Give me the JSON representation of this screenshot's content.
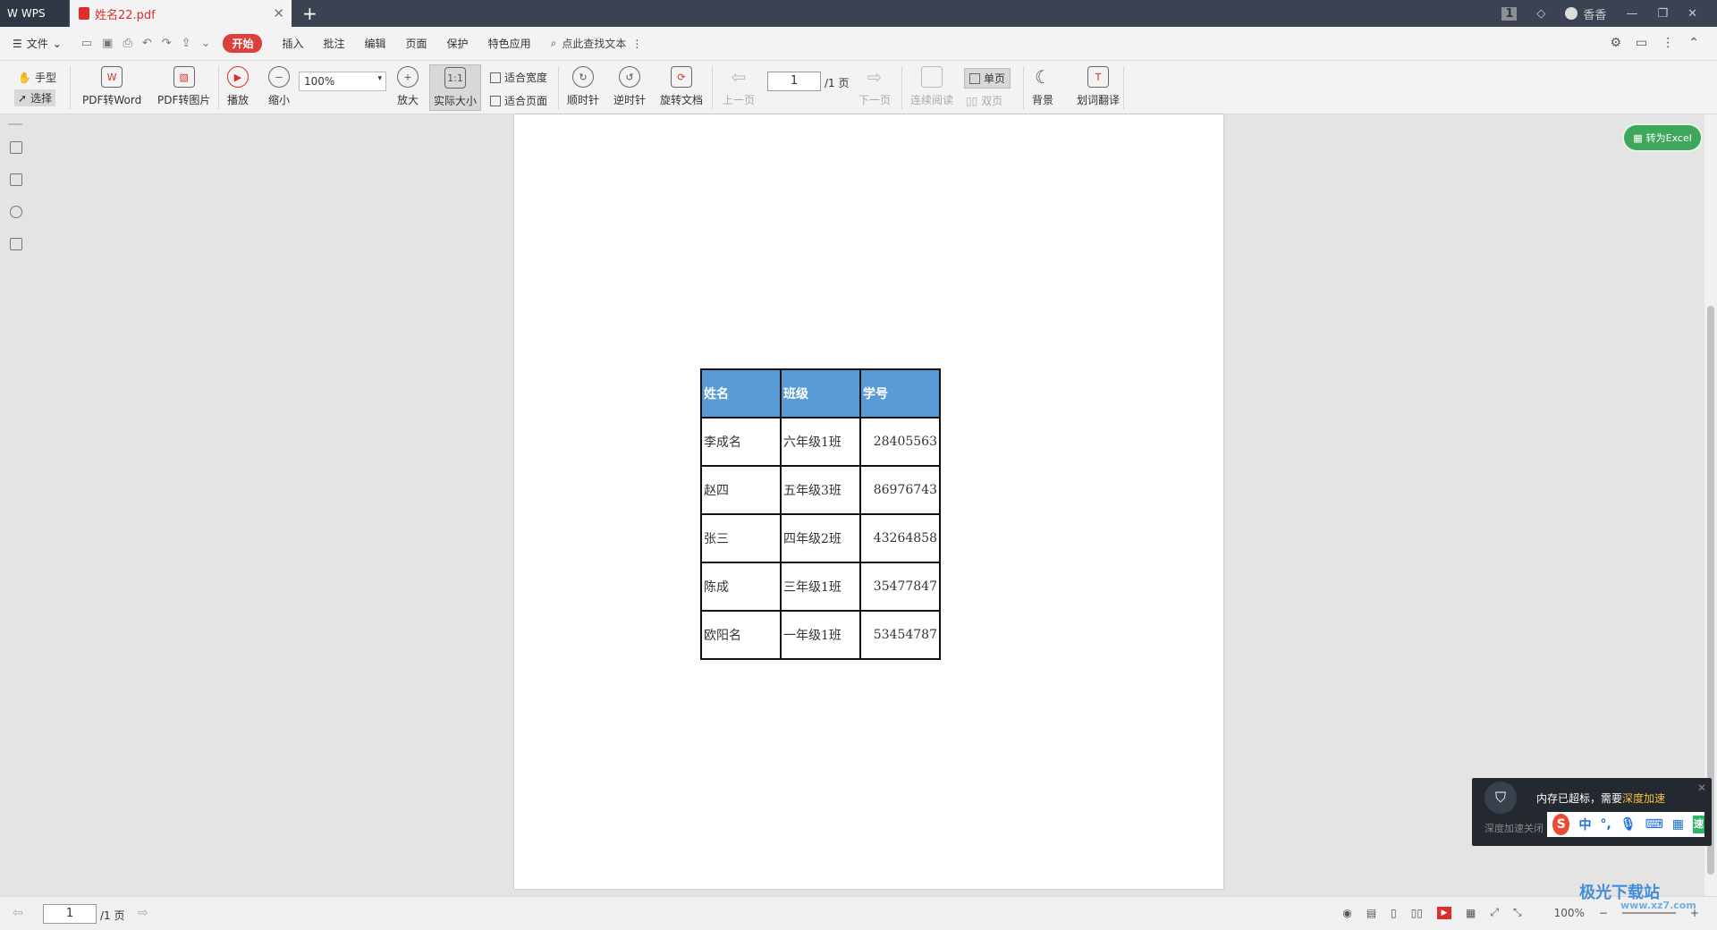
{
  "titlebar": {
    "app_tab": "WPS",
    "file_tab": "姓名22.pdf",
    "add_tab": "+",
    "user": "香香",
    "badge": "1"
  },
  "menubar": {
    "file": "文件",
    "items": [
      "开始",
      "插入",
      "批注",
      "编辑",
      "页面",
      "保护",
      "特色应用"
    ],
    "search_label": "点此查找文本"
  },
  "toolbar": {
    "hand": "手型",
    "select": "选择",
    "pdf_to_word": "PDF转Word",
    "pdf_to_image": "PDF转图片",
    "play": "播放",
    "zoom_out": "缩小",
    "zoom_value": "100%",
    "zoom_in": "放大",
    "actual_size": "实际大小",
    "fit_width": "适合宽度",
    "fit_page": "适合页面",
    "clockwise": "顺时针",
    "counterclockwise": "逆时针",
    "rotate_doc": "旋转文档",
    "prev_page": "上一页",
    "page_value": "1",
    "page_total": "/1 页",
    "next_page": "下一页",
    "continuous": "连续阅读",
    "single": "单页",
    "double": "双页",
    "background": "背景",
    "translate": "划词翻译"
  },
  "document": {
    "headers": [
      "姓名",
      "班级",
      "学号"
    ],
    "rows": [
      [
        "李成名",
        "六年级1班",
        "28405563"
      ],
      [
        "赵四",
        "五年级3班",
        "86976743"
      ],
      [
        "张三",
        "四年级2班",
        "43264858"
      ],
      [
        "陈成",
        "三年级1班",
        "35477847"
      ],
      [
        "欧阳名",
        "一年级1班",
        "53454787"
      ]
    ]
  },
  "convert_excel": "转为Excel",
  "popup": {
    "message": "内存已超标，需要",
    "highlight": "深度加速",
    "sub": "深度加速关闭",
    "ime_chars": [
      "中",
      "°,"
    ],
    "ime_tail": "速"
  },
  "statusbar": {
    "page_value": "1",
    "page_total": "/1 页",
    "zoom": "100%"
  },
  "watermark": {
    "text": "极光下载站",
    "url": "www.xz7.com"
  }
}
